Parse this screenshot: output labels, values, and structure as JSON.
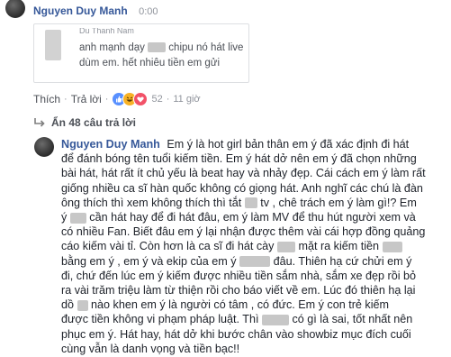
{
  "top_comment": {
    "author": "Nguyen Duy Manh",
    "time": "0:00"
  },
  "quoted_reply": {
    "author_fragment": "Du Thanh Nam",
    "line1_a": "anh mạnh dạy",
    "line1_b": "chipu nó hát live",
    "line2": "dùm em. hết nhiêu tiền em gửi"
  },
  "actions": {
    "like": "Thích",
    "sep1": "·",
    "reply": "Trả lời",
    "sep2": "·",
    "reactions_count": "52",
    "sep3": "·",
    "time": "11 giờ"
  },
  "hidden_replies": {
    "label": "Ẩn 48 câu trả lời"
  },
  "reply": {
    "author": "Nguyen Duy Manh",
    "lines": [
      [
        "Em ý là hot girl bản thân em ý đã xác định đi hát"
      ],
      [
        "để đánh bóng tên tuổi kiếm tiền. Em ý hát dở nên em ý đã chọn những"
      ],
      [
        "bài hát, hát rất ít chủ yếu là beat hay và nhảy đẹp. Cái cách em ý làm rất"
      ],
      [
        "giống nhiều ca sĩ hàn quốc không có giọng hát. Anh nghĩ các chú là đàn"
      ],
      [
        "ông thích thì xem không thích thì tắt",
        "tv , chê trách em ý làm gì!? Em"
      ],
      [
        "ý",
        "cần hát hay để đi hát đâu, em ý làm MV để thu hút người xem và"
      ],
      [
        "có nhiều Fan. Biết đâu em ý lại nhận được thêm vài cái hợp đồng quảng"
      ],
      [
        "cáo kiếm vài tỉ. Còn hơn là ca sĩ đi hát cày",
        "mặt ra kiếm tiền"
      ],
      [
        "bằng em ý , em ý và ekip của em ý",
        "đâu. Thiên hạ cứ chửi em ý"
      ],
      [
        "đi, chứ đến lúc em ý kiếm được nhiều tiền sắm nhà, sắm xe đẹp rồi bỏ"
      ],
      [
        "ra vài trăm triệu làm từ thiện rồi cho báo viết về em. Lúc đó thiên hạ lại"
      ],
      [
        "dồ",
        "nào khen em ý là người có tâm , có đức. Em ý con trẻ kiếm"
      ],
      [
        "được tiền không vi phạm pháp luật. Thì",
        "có gì là sai, tốt nhất nên"
      ],
      [
        "phục em ý. Hát hay, hát dở khi bước chân vào showbiz mục đích cuối"
      ],
      [
        "cùng vẫn là danh vọng và tiền bạc!!"
      ]
    ]
  },
  "colors": {
    "name": "#365899",
    "meta": "#90949c",
    "text": "#1d2129",
    "like_reaction": "#5890ff",
    "haha_reaction": "#f7b125",
    "love_reaction": "#f25268"
  },
  "icons": {
    "reply_arrow": "reply-arrow-icon",
    "reactions": [
      "like-reaction-icon",
      "haha-reaction-icon",
      "love-reaction-icon"
    ]
  }
}
